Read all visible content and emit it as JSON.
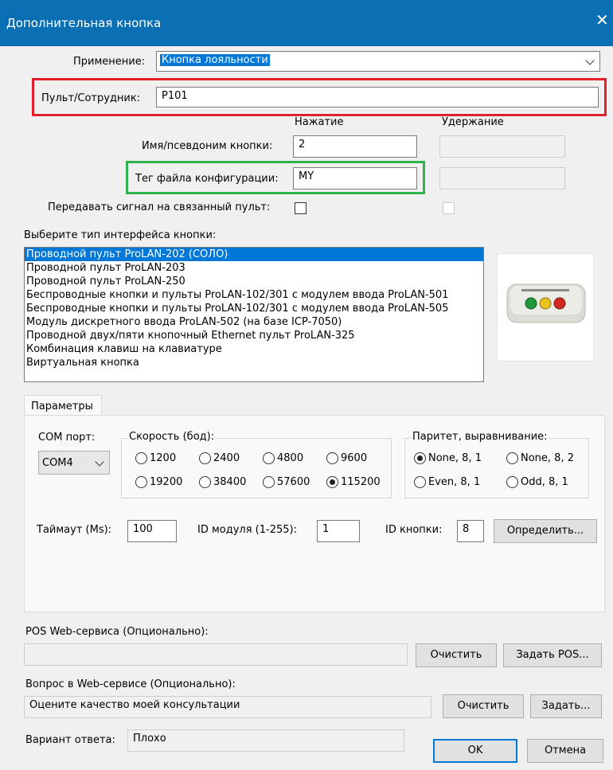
{
  "window": {
    "title": "Дополнительная кнопка",
    "close_glyph": "✕"
  },
  "application": {
    "label": "Применение:",
    "value": "Кнопка лояльности"
  },
  "console": {
    "label": "Пульт/Сотрудник:",
    "value": "P101"
  },
  "columns": {
    "press": "Нажатие",
    "hold": "Удержание"
  },
  "button_name": {
    "label": "Имя/псевдоним кнопки:",
    "press_value": "2",
    "hold_value": ""
  },
  "config_tag": {
    "label": "Тег файла конфигурации:",
    "press_value": "MY",
    "hold_value": ""
  },
  "forward_signal": {
    "label": "Передавать сигнал на связанный пульт:"
  },
  "interface": {
    "label": "Выберите тип интерфейса кнопки:",
    "items": [
      "Проводной пульт ProLAN-202 (СОЛО)",
      "Проводной пульт ProLAN-203",
      "Проводной пульт ProLAN-250",
      "Беспроводные кнопки и пульты ProLAN-102/301 с модулем ввода ProLAN-501",
      "Беспроводные кнопки и пульты ProLAN-102/301 с модулем ввода ProLAN-505",
      "Модуль дискретного ввода ProLAN-502 (на базе ICP-7050)",
      "Проводной двух/пяти кнопочный Ethernet пульт ProLAN-325",
      "Комбинация клавиш на клавиатуре",
      "Виртуальная кнопка"
    ],
    "selected_index": 0
  },
  "params": {
    "tab_label": "Параметры",
    "com_label": "COM порт:",
    "com_value": "COM4",
    "speed_label": "Скорость (бод):",
    "speeds": [
      "1200",
      "2400",
      "4800",
      "9600",
      "19200",
      "38400",
      "57600",
      "115200"
    ],
    "speed_selected": "115200",
    "parity_label": "Паритет, выравнивание:",
    "parities": [
      "None, 8, 1",
      "None, 8, 2",
      "Even, 8, 1",
      "Odd, 8, 1"
    ],
    "parity_selected": "None, 8, 1",
    "timeout_label": "Таймаут (Ms):",
    "timeout_value": "100",
    "module_label": "ID модуля (1-255):",
    "module_value": "1",
    "buttonid_label": "ID кнопки:",
    "buttonid_value": "8",
    "detect_label": "Определить..."
  },
  "pos": {
    "label": "POS Web-сервиса (Опционально):",
    "value": "",
    "clear_label": "Очистить",
    "set_label": "Задать POS..."
  },
  "question": {
    "label": "Вопрос в Web-сервисе (Опционально):",
    "value": "Оцените качество моей консультации",
    "clear_label": "Очистить",
    "set_label": "Задать..."
  },
  "answer": {
    "label": "Вариант ответа:",
    "value": "Плохо"
  },
  "footer": {
    "ok_label": "OK",
    "cancel_label": "Отмена"
  },
  "colors": {
    "titlebar": "#0b6fb3",
    "selection": "#0078d7",
    "highlight_red": "#e0202a",
    "highlight_green": "#2fb14b"
  }
}
